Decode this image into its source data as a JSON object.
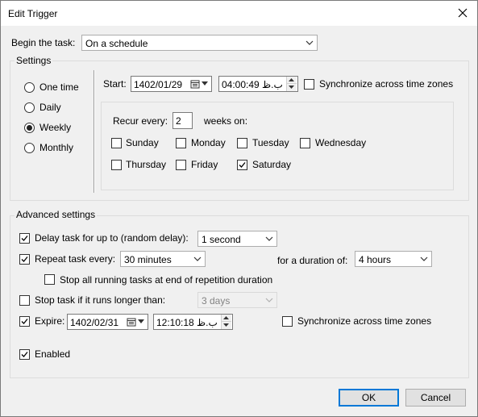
{
  "window": {
    "title": "Edit Trigger"
  },
  "begin": {
    "label": "Begin the task:",
    "value": "On a schedule"
  },
  "settings": {
    "label": "Settings",
    "frequency": [
      {
        "label": "One time",
        "selected": false
      },
      {
        "label": "Daily",
        "selected": false
      },
      {
        "label": "Weekly",
        "selected": true
      },
      {
        "label": "Monthly",
        "selected": false
      }
    ],
    "start_label": "Start:",
    "start_date": "1402/01/29",
    "start_time": "04:00:49 ب.ظ",
    "sync_label": "Synchronize across time zones",
    "sync_checked": false,
    "recur_label": "Recur every:",
    "recur_value": "2",
    "weeks_on_label": "weeks on:",
    "days": [
      {
        "label": "Sunday",
        "checked": false
      },
      {
        "label": "Monday",
        "checked": false
      },
      {
        "label": "Tuesday",
        "checked": false
      },
      {
        "label": "Wednesday",
        "checked": false
      },
      {
        "label": "Thursday",
        "checked": false
      },
      {
        "label": "Friday",
        "checked": false
      },
      {
        "label": "Saturday",
        "checked": true
      }
    ]
  },
  "advanced": {
    "label": "Advanced settings",
    "delay_label": "Delay task for up to (random delay):",
    "delay_checked": true,
    "delay_value": "1 second",
    "repeat_label": "Repeat task every:",
    "repeat_checked": true,
    "repeat_value": "30 minutes",
    "duration_label": "for a duration of:",
    "duration_value": "4 hours",
    "stop_running_label": "Stop all running tasks at end of repetition duration",
    "stop_running_checked": false,
    "stop_longer_label": "Stop task if it runs longer than:",
    "stop_longer_checked": false,
    "stop_longer_value": "3 days",
    "expire_label": "Expire:",
    "expire_checked": true,
    "expire_date": "1402/02/31",
    "expire_time": "12:10:18 ب.ظ",
    "expire_sync_label": "Synchronize across time zones",
    "expire_sync_checked": false,
    "enabled_label": "Enabled",
    "enabled_checked": true
  },
  "buttons": {
    "ok": "OK",
    "cancel": "Cancel"
  }
}
